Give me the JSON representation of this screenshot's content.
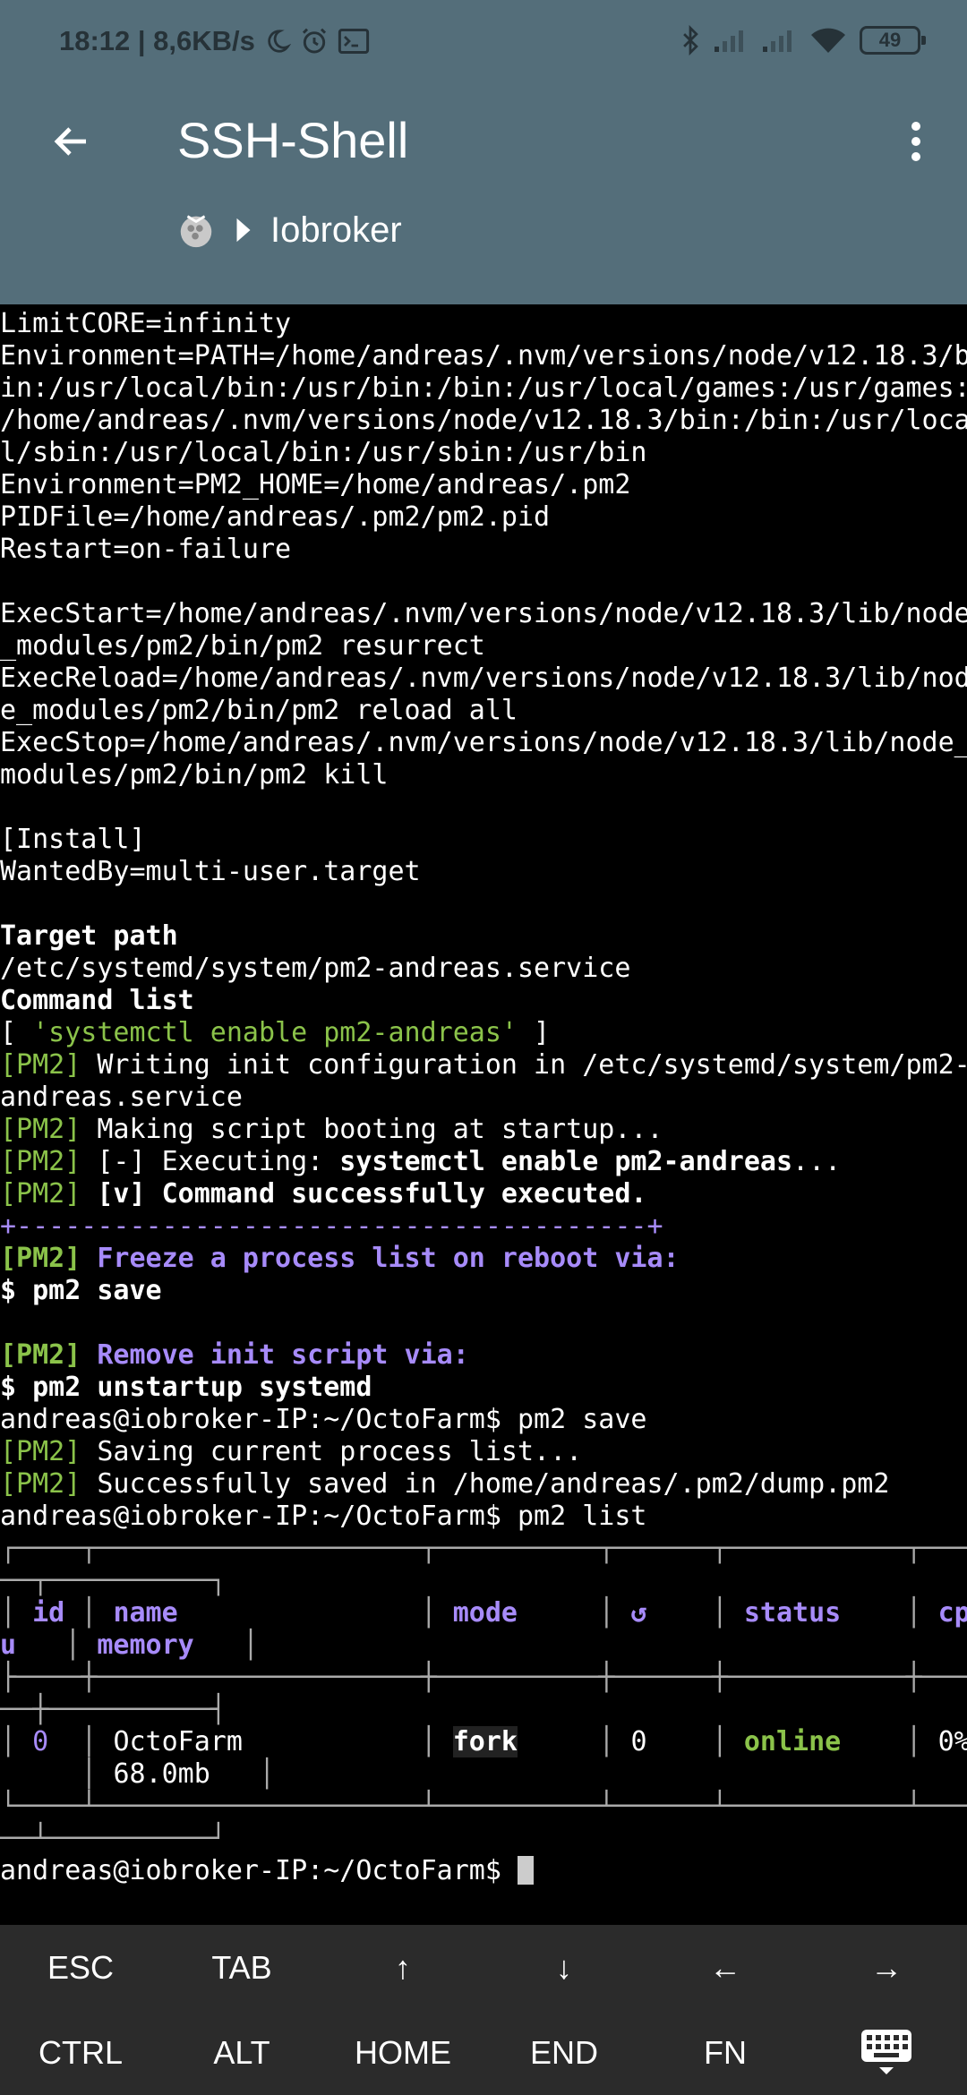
{
  "status_bar": {
    "time_speed": "18:12 | 8,6KB/s",
    "battery": "49",
    "icons": [
      "moon-icon",
      "alarm-icon",
      "terminal-icon",
      "bluetooth-icon",
      "signal-icon",
      "signal-icon",
      "wifi-icon",
      "battery-icon"
    ]
  },
  "toolbar": {
    "title": "SSH-Shell",
    "breadcrumb_host": "Iobroker"
  },
  "terminal": {
    "l01": "LimitCORE=infinity",
    "l02": "Environment=PATH=/home/andreas/.nvm/versions/node/v12.18.3/b",
    "l03": "in:/usr/local/bin:/usr/bin:/bin:/usr/local/games:/usr/games:",
    "l04": "/home/andreas/.nvm/versions/node/v12.18.3/bin:/bin:/usr/loca",
    "l05": "l/sbin:/usr/local/bin:/usr/sbin:/usr/bin",
    "l06": "Environment=PM2_HOME=/home/andreas/.pm2",
    "l07": "PIDFile=/home/andreas/.pm2/pm2.pid",
    "l08": "Restart=on-failure",
    "l09": "",
    "l10": "ExecStart=/home/andreas/.nvm/versions/node/v12.18.3/lib/node",
    "l11": "_modules/pm2/bin/pm2 resurrect",
    "l12": "ExecReload=/home/andreas/.nvm/versions/node/v12.18.3/lib/nod",
    "l13": "e_modules/pm2/bin/pm2 reload all",
    "l14": "ExecStop=/home/andreas/.nvm/versions/node/v12.18.3/lib/node_",
    "l15": "modules/pm2/bin/pm2 kill",
    "l16": "",
    "l17": "[Install]",
    "l18": "WantedBy=multi-user.target",
    "l19": "",
    "l20": "Target path",
    "l21": "/etc/systemd/system/pm2-andreas.service",
    "l22": "Command list",
    "l23a": "[ ",
    "l23b": "'systemctl enable pm2-andreas'",
    "l23c": " ]",
    "pm2": "[PM2]",
    "l24": " Writing init configuration in /etc/systemd/system/pm2-",
    "l25": "andreas.service",
    "l26": " Making script booting at startup...",
    "l27a": " [-] Executing: ",
    "l27b": "systemctl enable pm2-andreas",
    "l27c": "...",
    "l28a": " ",
    "l28b": "[v] Command successfully executed.",
    "l29": "+---------------------------------------+",
    "l30": " Freeze a process list on reboot via:",
    "l31": "$ pm2 save",
    "l32": "",
    "l33": " Remove init script via:",
    "l34": "$ pm2 unstartup systemd",
    "l35": "andreas@iobroker-IP:~/OctoFarm$ pm2 save",
    "l36": " Saving current process list...",
    "l37": " Successfully saved in /home/andreas/.pm2/dump.pm2",
    "l38": "andreas@iobroker-IP:~/OctoFarm$ pm2 list",
    "t1": "┌────┬────────────────────┬──────────┬──────┬───────────┬────",
    "t1b": "──┬──────────┐",
    "t2a": "│ ",
    "t2id": "id",
    "t2b": " │ ",
    "t2name": "name",
    "t2c": "               │ ",
    "t2mode": "mode",
    "t2d": "     │ ",
    "t2re": "↺",
    "t2e": "    │ ",
    "t2status": "status",
    "t2f": "    │ ",
    "t2cpu": "cp",
    "t3a": "u",
    "t3b": "   │ ",
    "t3mem": "memory",
    "t3c": "   │",
    "t4": "├────┼────────────────────┼──────────┼──────┼───────────┼────",
    "t4b": "──┼──────────┤",
    "t5a": "│ ",
    "t5id": "0",
    "t5b": "  │ ",
    "t5name": "OctoFarm",
    "t5c": "           │ ",
    "t5mode": "fork",
    "t5d": "     │ ",
    "t5re": "0",
    "t5e": "    │ ",
    "t5status": "online",
    "t5f": "    │ ",
    "t5cpu": "0%",
    "t6a": "     │ ",
    "t6mem": "68.0mb",
    "t6b": "   │",
    "t7": "└────┴────────────────────┴──────────┴──────┴───────────┴────",
    "t7b": "──┴──────────┘",
    "prompt": "andreas@iobroker-IP:~/OctoFarm$ "
  },
  "keys": {
    "row1": [
      "ESC",
      "TAB",
      "↑",
      "↓",
      "←",
      "→"
    ],
    "row2": [
      "CTRL",
      "ALT",
      "HOME",
      "END",
      "FN"
    ]
  }
}
